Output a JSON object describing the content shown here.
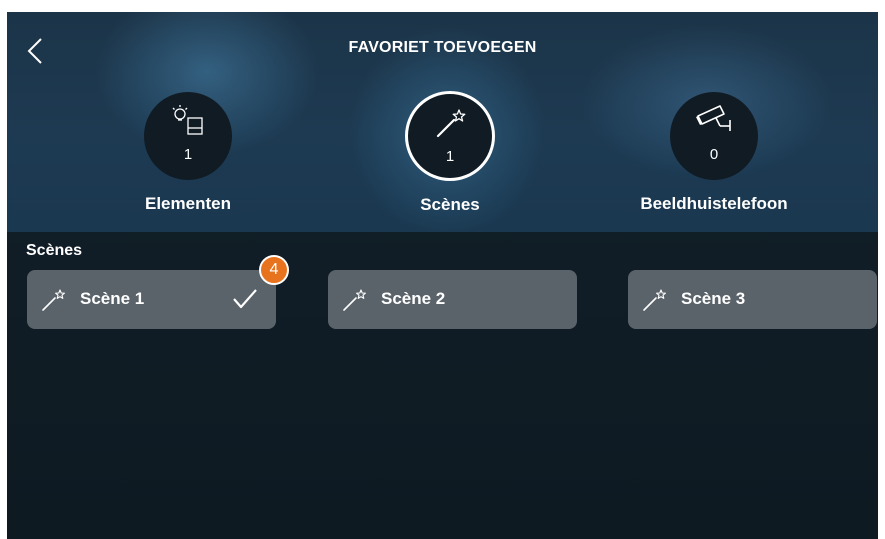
{
  "header": {
    "title": "FAVORIET TOEVOEGEN",
    "back_icon": "chevron-left-icon"
  },
  "categories": [
    {
      "label": "Elementen",
      "count": "1",
      "icon": "lightbulb-switch-icon",
      "selected": false
    },
    {
      "label": "Scènes",
      "count": "1",
      "icon": "magic-wand-icon",
      "selected": true
    },
    {
      "label": "Beeldhuistelefoon",
      "count": "0",
      "icon": "security-camera-icon",
      "selected": false
    }
  ],
  "section": {
    "title": "Scènes"
  },
  "scenes": [
    {
      "label": "Scène 1",
      "icon": "magic-wand-icon",
      "selected": true
    },
    {
      "label": "Scène 2",
      "icon": "magic-wand-icon",
      "selected": false
    },
    {
      "label": "Scène 3",
      "icon": "magic-wand-icon",
      "selected": false
    }
  ],
  "callout": {
    "number": "4",
    "color": "#e8731e"
  },
  "colors": {
    "header_bg": "#1d3a52",
    "body_bg": "#0e1a22",
    "tile_bg": "#5a636a",
    "text": "#ffffff"
  }
}
